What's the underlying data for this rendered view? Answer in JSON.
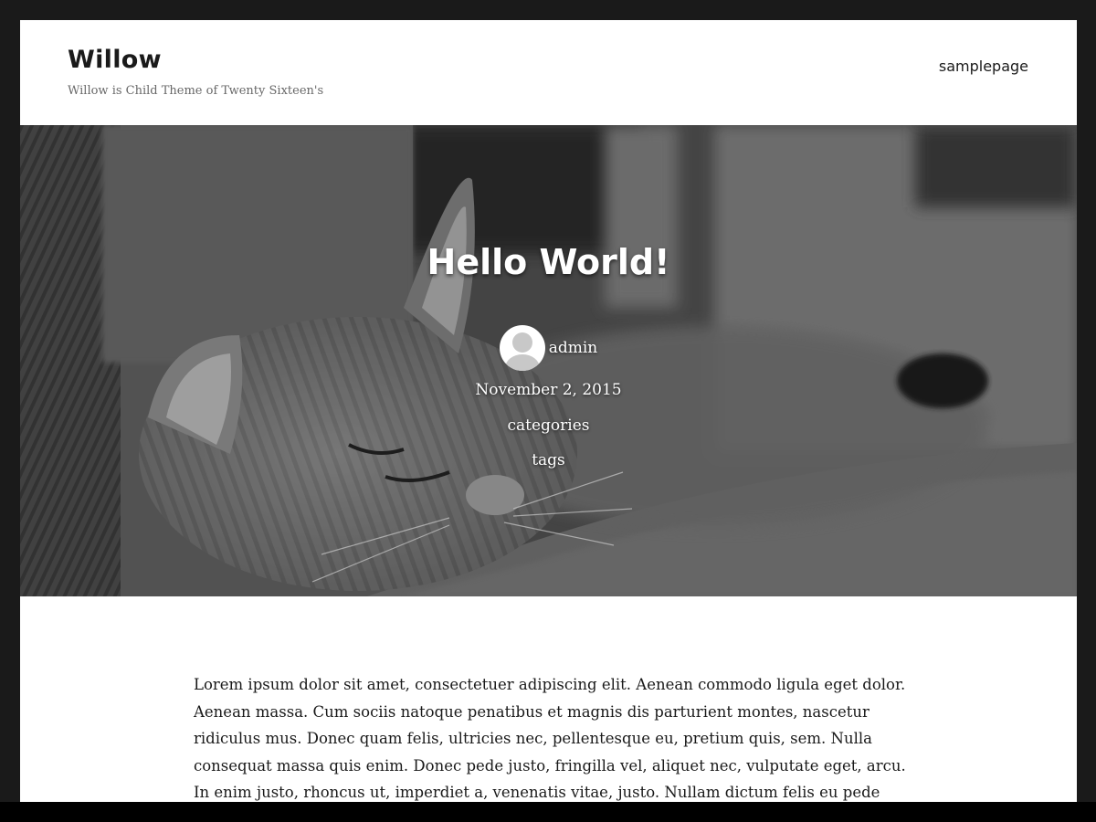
{
  "header": {
    "site_title": "Willow",
    "site_description": "Willow is Child Theme of Twenty Sixteen's"
  },
  "nav": {
    "items": [
      {
        "label": "samplepage"
      }
    ]
  },
  "post": {
    "title": "Hello World!",
    "author": "admin",
    "date": "November 2, 2015",
    "categories_label": "categories",
    "tags_label": "tags",
    "content": "Lorem ipsum dolor sit amet, consectetuer adipiscing elit. Aenean commodo ligula eget dolor. Aenean massa. Cum sociis natoque penatibus et magnis dis parturient montes, nascetur ridiculus mus. Donec quam felis, ultricies nec, pellentesque eu, pretium quis, sem. Nulla consequat massa quis enim. Donec pede justo, fringilla vel, aliquet nec, vulputate eget, arcu. In enim justo, rhoncus ut, imperdiet a, venenatis vitae, justo. Nullam dictum felis eu pede"
  },
  "colors": {
    "frame": "#1a1a1a",
    "page_background": "#ffffff",
    "text": "#1a1a1a",
    "muted_text": "#686868",
    "hero_text": "#ffffff"
  },
  "icons": {
    "avatar": "default-user-avatar-icon"
  }
}
